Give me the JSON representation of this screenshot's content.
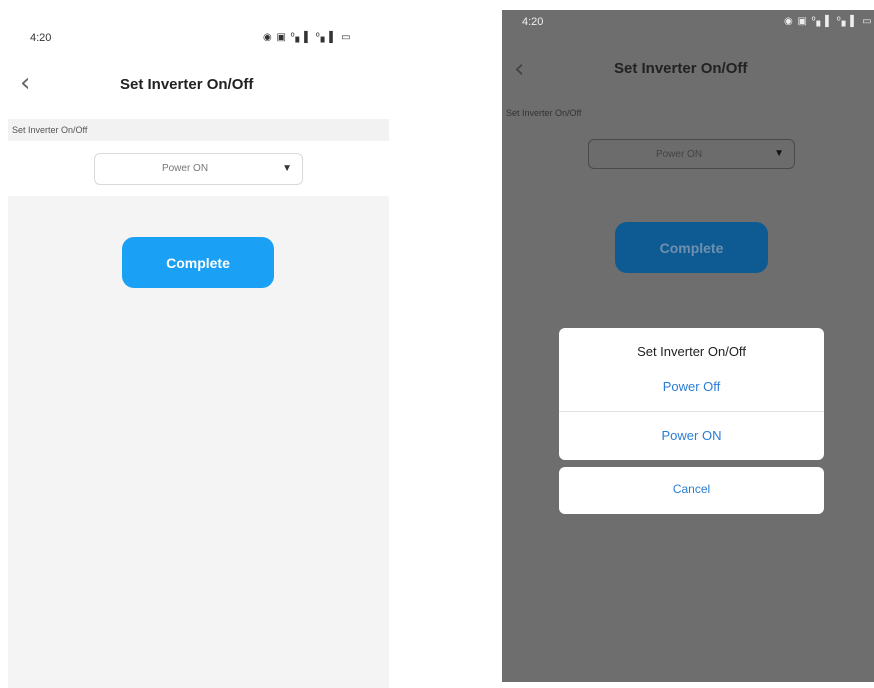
{
  "left_screen": {
    "status_bar": {
      "time": "4:20",
      "icons": "◉ ▣ º▖▌ º▖▌ ▭"
    },
    "header": {
      "back_icon": "chevron-left-icon",
      "back_glyph": "‹",
      "title": "Set Inverter On/Off"
    },
    "section_label": "Set Inverter On/Off",
    "dropdown": {
      "value": "Power ON",
      "arrow_glyph": "▼"
    },
    "complete_button": {
      "label": "Complete",
      "color": "#1aa0f5"
    }
  },
  "right_screen": {
    "status_bar": {
      "time": "4:20",
      "icons": "◉ ▣ º▖▌ º▖▌ ▭"
    },
    "header": {
      "back_icon": "chevron-left-icon",
      "back_glyph": "‹",
      "title": "Set Inverter On/Off"
    },
    "section_label": "Set Inverter On/Off",
    "dropdown": {
      "value": "Power ON",
      "arrow_glyph": "▼"
    },
    "complete_button": {
      "label": "Complete",
      "color": "#0e5b94"
    },
    "action_sheet": {
      "title": "Set Inverter On/Off",
      "options": [
        "Power Off",
        "Power ON"
      ],
      "option_color": "#2a7dd6",
      "cancel_label": "Cancel"
    },
    "overlay_color": "#6e6e6e"
  }
}
